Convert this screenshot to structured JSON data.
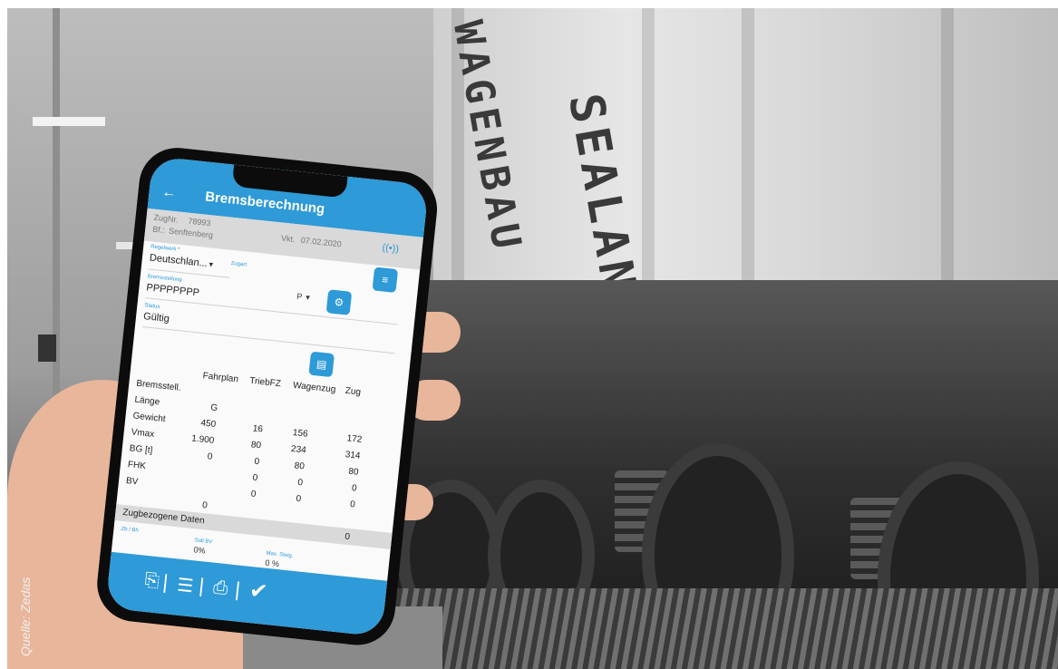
{
  "wagon_lettering": [
    "WAGENBAU",
    "SEALAND"
  ],
  "app": {
    "title": "Bremsberechnung",
    "back_icon": "arrow-left-icon",
    "signal_icon": "wireless-icon",
    "zug_label": "ZugNr.",
    "zug_value": "78993",
    "bf_label": "Bf.:",
    "bf_value": "Senftenberg",
    "vkt_label": "Vkt.",
    "vkt_value": "07.02.2020",
    "regelwerk_label": "Regelwerk *",
    "regelwerk_value": "Deutschlan...",
    "zugart_label": "Zugart",
    "zugart_value": "P",
    "bremsstellung_label": "Bremsstellung",
    "bremsstellung_value": "PPPPPPPP",
    "status_label": "Status",
    "status_value": "Gültig",
    "table": {
      "headers": [
        "Fahrplan",
        "TriebFZ",
        "Wagenzug",
        "Zug"
      ],
      "rows": [
        {
          "label": "Bremsstell.",
          "cells": [
            "",
            "",
            "",
            ""
          ]
        },
        {
          "label": "Länge",
          "cells": [
            "G",
            "",
            "",
            ""
          ]
        },
        {
          "label": "Gewicht",
          "cells": [
            "450",
            "16",
            "156",
            "172"
          ]
        },
        {
          "label": "Vmax",
          "cells": [
            "1.900",
            "80",
            "234",
            "314"
          ]
        },
        {
          "label": "BG [t]",
          "cells": [
            "0",
            "0",
            "80",
            "80"
          ]
        },
        {
          "label": "FHK",
          "cells": [
            "",
            "0",
            "0",
            "0"
          ]
        },
        {
          "label": "BV",
          "cells": [
            "",
            "0",
            "0",
            "0"
          ]
        }
      ],
      "extra_zero": "0",
      "extra_zero_2": "0"
    },
    "section_title": "Zugbezogene Daten",
    "zugdaten": {
      "label1": "Zb / Bh",
      "label2": "Soll BV",
      "value2": "0%",
      "label3": "Max. Steig.",
      "value3": "0 %"
    },
    "bottom_icons": [
      "train-document-icon",
      "list-icon",
      "print-icon",
      "check-icon"
    ]
  },
  "credit": "Quelle: Zedas"
}
